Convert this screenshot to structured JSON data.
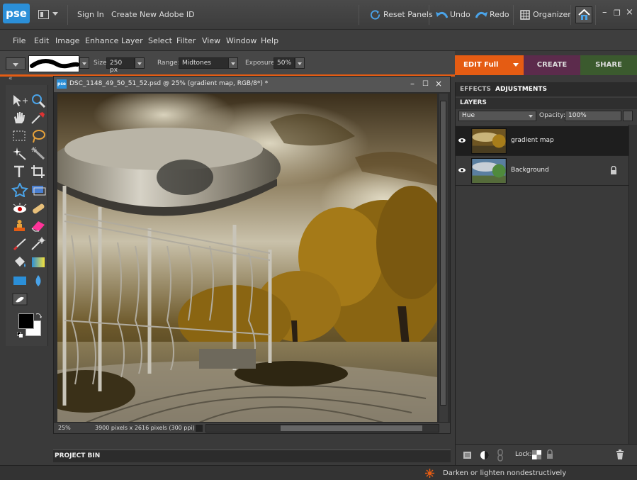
{
  "app": {
    "logo_text": "pse"
  },
  "titlebar": {
    "sign_in": "Sign In",
    "create_id": "Create New Adobe ID",
    "reset_panels": "Reset Panels",
    "undo": "Undo",
    "redo": "Redo",
    "organizer": "Organizer",
    "minimize": "–",
    "restore": "❐",
    "close": "×"
  },
  "menu": [
    "File",
    "Edit",
    "Image",
    "Enhance",
    "Layer",
    "Select",
    "Filter",
    "View",
    "Window",
    "Help"
  ],
  "options": {
    "size_label": "Size:",
    "size_value": "250 px",
    "range_label": "Range:",
    "range_value": "Midtones",
    "exposure_label": "Exposure:",
    "exposure_value": "50%"
  },
  "modes": {
    "edit": "EDIT Full",
    "create": "CREATE",
    "share": "SHARE"
  },
  "document": {
    "title": "DSC_1148_49_50_51_52.psd @ 25% (gradient map, RGB/8*) *",
    "zoom": "25%",
    "info": "3900 pixels x 2616 pixels (300 ppi)",
    "min": "–",
    "max": "☐",
    "close": "×"
  },
  "project_bin": "PROJECT BIN",
  "panel": {
    "tab_effects": "EFFECTS",
    "tab_adjustments": "ADJUSTMENTS",
    "layers_title": "LAYERS",
    "blend_mode": "Hue",
    "opacity_label": "Opacity:",
    "opacity_value": "100%",
    "lock_label": "Lock:",
    "layers": [
      {
        "name": "gradient map"
      },
      {
        "name": "Background"
      }
    ]
  },
  "status": {
    "message": "Darken or lighten nondestructively"
  },
  "colors": {
    "accent_edit": "#e55c13",
    "create": "#5c2b4c",
    "share": "#3b5a2e",
    "brand": "#2b8fd8"
  }
}
